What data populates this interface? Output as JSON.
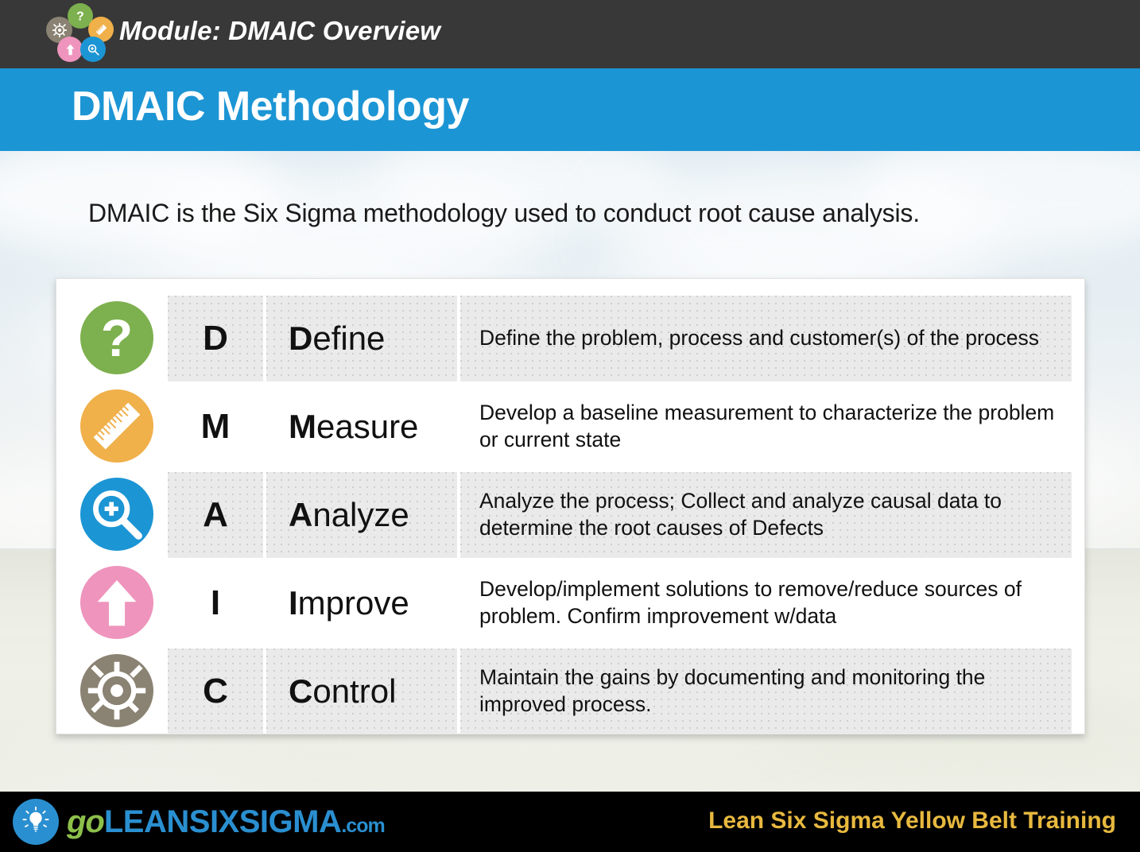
{
  "topbar": {
    "module_title": "Module: DMAIC Overview",
    "background_color": "#383838",
    "icons": [
      {
        "name": "ship-wheel-icon",
        "color": "#8a8272"
      },
      {
        "name": "question-mark-icon",
        "color": "#7db04e"
      },
      {
        "name": "ruler-icon",
        "color": "#f0b04a"
      },
      {
        "name": "arrow-up-icon",
        "color": "#ee94bd"
      },
      {
        "name": "magnifier-plus-icon",
        "color": "#1c95d4"
      }
    ]
  },
  "banner": {
    "title": "DMAIC Methodology",
    "background_color": "#1c95d4",
    "text_color": "#ffffff"
  },
  "intro": {
    "text": "DMAIC is the Six Sigma methodology used to conduct root cause analysis."
  },
  "table": {
    "rows": [
      {
        "icon": "question-mark-icon",
        "icon_color": "#7db04e",
        "letter": "D",
        "word_cap": "D",
        "word_rest": "efine",
        "description": "Define the problem, process and customer(s) of the process",
        "shaded": true
      },
      {
        "icon": "ruler-icon",
        "icon_color": "#f0b04a",
        "letter": "M",
        "word_cap": "M",
        "word_rest": "easure",
        "description": "Develop a baseline measurement to characterize the problem or current state",
        "shaded": false
      },
      {
        "icon": "magnifier-plus-icon",
        "icon_color": "#1c95d4",
        "letter": "A",
        "word_cap": "A",
        "word_rest": "nalyze",
        "description": "Analyze the process; Collect and analyze causal data to determine the root causes of Defects",
        "shaded": true
      },
      {
        "icon": "arrow-up-icon",
        "icon_color": "#ee94bd",
        "letter": "I",
        "word_cap": "I",
        "word_rest": "mprove",
        "description": "Develop/implement solutions to remove/reduce sources of problem. Confirm improvement w/data",
        "shaded": false
      },
      {
        "icon": "ship-wheel-icon",
        "icon_color": "#8a8272",
        "letter": "C",
        "word_cap": "C",
        "word_rest": "ontrol",
        "description": "Maintain the gains by documenting and monitoring the improved process.",
        "shaded": true
      }
    ]
  },
  "footer": {
    "background_color": "#000000",
    "logo": {
      "icon": "lightbulb-icon",
      "badge_color": "#2a8fd0",
      "go": "go",
      "go_color": "#8cc04a",
      "leansixsigma": "LEANSIXSIGMA",
      "leansixsigma_color": "#2a8fd0",
      "dotcom": ".com"
    },
    "right_text": "Lean Six Sigma Yellow Belt Training",
    "right_text_color": "#e8b93f"
  }
}
